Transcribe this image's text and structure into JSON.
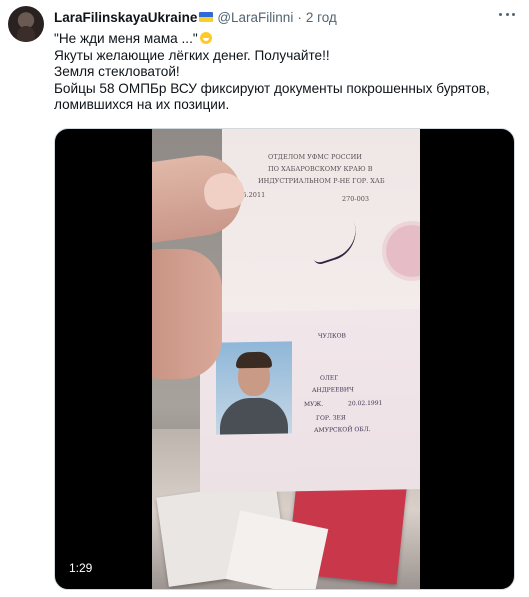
{
  "tweet": {
    "author_name": "LaraFilinskayaUkraine",
    "handle": "@LaraFilinni",
    "separator": "·",
    "time": "2 год",
    "lines": [
      "\"Не жди меня мама ...\"",
      "Якуты желающие лёгких денег. Получайте!!",
      "Земля стекловатой!",
      "Бойцы 58 ОМПБр ВСУ фиксируют документы покрошенных бурятов,",
      "ломившихся на их позиции."
    ],
    "emoji": "grinning-face-emoji",
    "flag_colors": {
      "top": "#2f6bd6",
      "bottom": "#f6cf2a"
    }
  },
  "media": {
    "type": "video",
    "duration": "1:29",
    "document": {
      "issuer_lines": [
        "ОТДЕЛОМ УФМС РОССИИ",
        "ПО ХАБАРОВСКОМУ КРАЮ В",
        "ИНДУСТРИАЛЬНОМ Р-НЕ ГОР. ХАБ"
      ],
      "issue_date": "19.05.2011",
      "code": "270-003",
      "surname": "ЧУЛКОВ",
      "given_name": "ОЛЕГ",
      "patronymic": "АНДРЕЕВИЧ",
      "sex": "МУЖ.",
      "birth_date": "20.02.1991",
      "birth_place_1": "ГОР. ЗЕЯ",
      "birth_place_2": "АМУРСКОЙ ОБЛ."
    }
  },
  "colors": {
    "text": "#0f1419",
    "secondary": "#536471",
    "border": "#cfd9de"
  }
}
